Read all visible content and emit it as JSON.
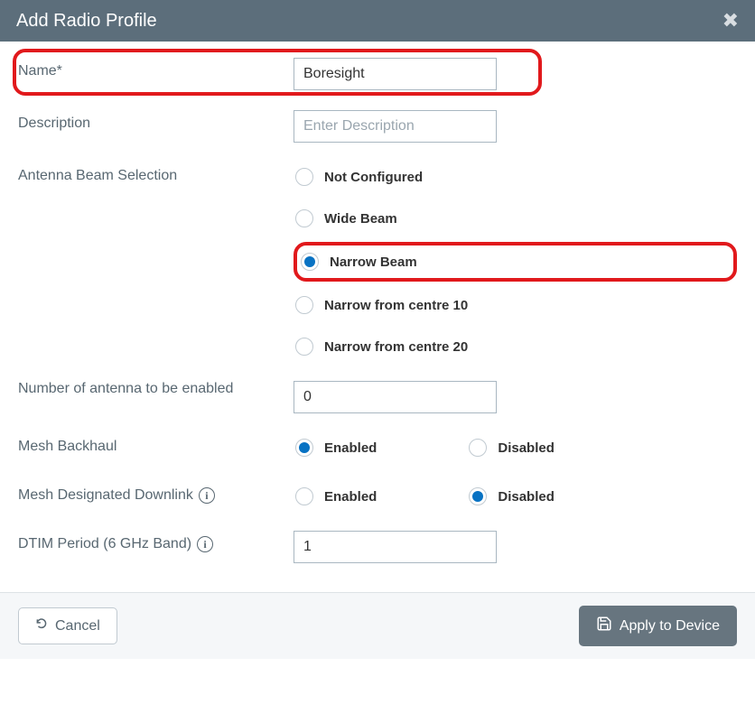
{
  "title": "Add Radio Profile",
  "fields": {
    "name": {
      "label": "Name*",
      "value": "Boresight"
    },
    "description": {
      "label": "Description",
      "placeholder": "Enter Description",
      "value": ""
    },
    "antenna_beam": {
      "label": "Antenna Beam Selection",
      "selected": "Narrow Beam",
      "options": {
        "opt0": "Not Configured",
        "opt1": "Wide Beam",
        "opt2": "Narrow Beam",
        "opt3": "Narrow from centre 10",
        "opt4": "Narrow from centre 20"
      }
    },
    "num_antenna": {
      "label": "Number of antenna to be enabled",
      "value": "0"
    },
    "mesh_backhaul": {
      "label": "Mesh Backhaul",
      "selected": "Enabled",
      "enabled_label": "Enabled",
      "disabled_label": "Disabled"
    },
    "mesh_downlink": {
      "label": "Mesh Designated Downlink",
      "selected": "Disabled",
      "enabled_label": "Enabled",
      "disabled_label": "Disabled"
    },
    "dtim": {
      "label": "DTIM Period (6 GHz Band)",
      "value": "1"
    }
  },
  "buttons": {
    "cancel": "Cancel",
    "apply": "Apply to Device"
  }
}
